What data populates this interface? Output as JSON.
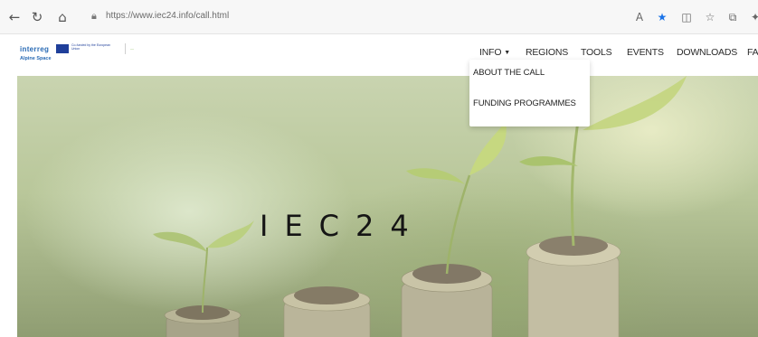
{
  "browser": {
    "url": "https://www.iec24.info/call.html",
    "nav_icons": [
      "back-icon",
      "refresh-icon",
      "home-icon"
    ],
    "toolbar_icons": [
      "read-aloud-icon",
      "favorite-star-icon",
      "split-screen-icon",
      "favorites-icon",
      "collections-icon",
      "extensions-icon"
    ]
  },
  "site": {
    "logo": {
      "brand": "interreg",
      "eu_text": "Co-funded by the European Union",
      "sub": "Alpine Space"
    },
    "nav": {
      "info": "INFO",
      "regions": "REGIONS",
      "tools": "TOOLS",
      "events": "EVENTS",
      "downloads": "DOWNLOADS",
      "fa": "FA"
    },
    "dropdown": {
      "items": [
        "ABOUT THE CALL",
        "FUNDING PROGRAMMES"
      ]
    },
    "hero": {
      "title": "IEC24"
    },
    "colors": {
      "brand_blue": "#2a6bb5",
      "browser_star": "#1a73e8"
    }
  }
}
